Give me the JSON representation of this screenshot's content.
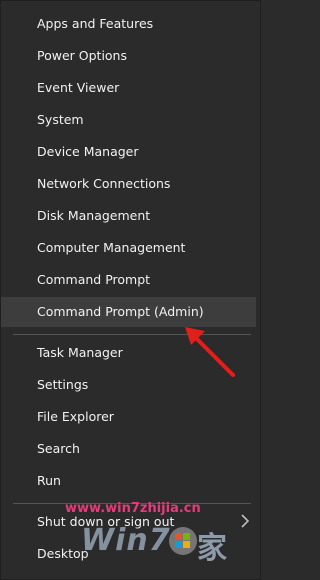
{
  "menu": {
    "items": [
      {
        "label": "Apps and Features"
      },
      {
        "label": "Power Options"
      },
      {
        "label": "Event Viewer"
      },
      {
        "label": "System"
      },
      {
        "label": "Device Manager"
      },
      {
        "label": "Network Connections"
      },
      {
        "label": "Disk Management"
      },
      {
        "label": "Computer Management"
      },
      {
        "label": "Command Prompt"
      },
      {
        "label": "Command Prompt (Admin)"
      },
      {
        "label": "Task Manager"
      },
      {
        "label": "Settings"
      },
      {
        "label": "File Explorer"
      },
      {
        "label": "Search"
      },
      {
        "label": "Run"
      },
      {
        "label": "Shut down or sign out"
      },
      {
        "label": "Desktop"
      }
    ]
  },
  "watermark": {
    "url": "www.win7zhijia.cn",
    "logo_text": "Win7",
    "logo_cn": "家"
  },
  "colors": {
    "background": "#2b2b2b",
    "hover": "#3d3d3d",
    "arrow": "#e0201b",
    "watermark_url": "#e53b7a"
  }
}
